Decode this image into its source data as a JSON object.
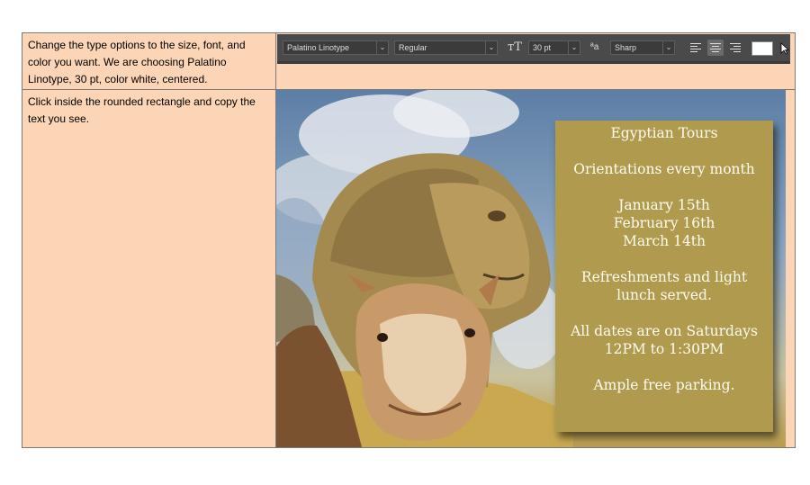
{
  "instructions": {
    "step1": "Change the type options to the size, font, and color you want. We are choosing Palatino Linotype, 30 pt, color white, centered.",
    "step2": "Click inside the rounded rectangle and copy the text you see."
  },
  "toolbar": {
    "font_family": "Palatino Linotype",
    "font_style": "Regular",
    "font_size": "30 pt",
    "antialias": "Sharp",
    "text_color": "#ffffff",
    "alignment": "center",
    "icons": [
      "text-orientation-icon",
      "font-size-icon",
      "antialias-icon",
      "align-left-icon",
      "align-center-icon",
      "align-right-icon",
      "color-swatch",
      "cursor-icon"
    ]
  },
  "flyer": {
    "title": "Egyptian Tours",
    "orientation": "Orientations every month",
    "date1": "January 15th",
    "date2": "February 16th",
    "date3": "March 14th",
    "refresh1": "Refreshments and light",
    "refresh2": "lunch served.",
    "sat1": "All dates are on Saturdays",
    "sat2": "12PM to 1:30PM",
    "parking": "Ample free parking."
  },
  "colors": {
    "table_background": "#fbd5b5",
    "flyer_background": "#b09a4d",
    "toolbar_background": "#4a4a4a"
  }
}
